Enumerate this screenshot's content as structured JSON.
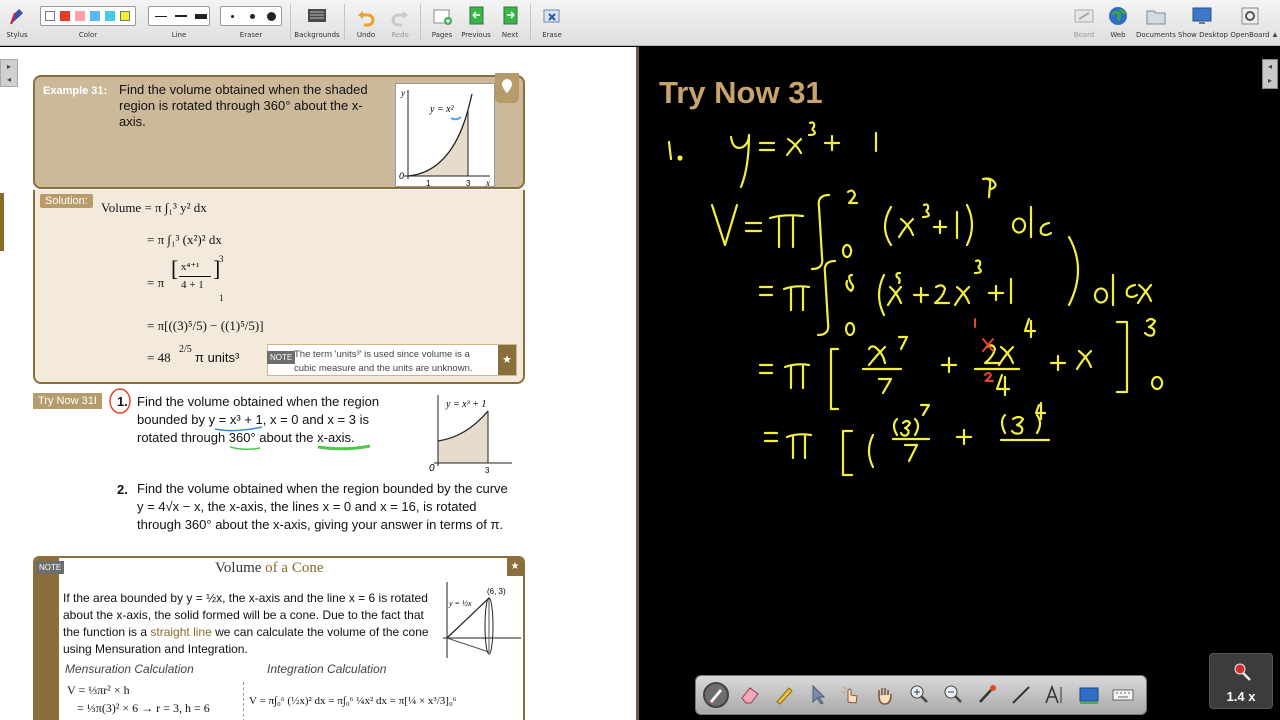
{
  "toolbar": {
    "stylus": "Stylus",
    "color": "Color",
    "line": "Line",
    "eraser": "Eraser",
    "backgrounds": "Backgrounds",
    "undo": "Undo",
    "redo": "Redo",
    "pages": "Pages",
    "previous": "Previous",
    "next": "Next",
    "erase": "Erase",
    "board": "Board",
    "web": "Web",
    "documents": "Documents",
    "show_desktop": "Show Desktop",
    "openboard": "OpenBoard",
    "colors": [
      "#ffffff",
      "#e53b2c",
      "#ff9ea6",
      "#5fb6f5",
      "#49c9e6",
      "#f6f02a"
    ]
  },
  "example": {
    "label": "Example 31:",
    "text": "Find the volume obtained when the shaded region is rotated through 360° about the x-axis.",
    "graph_label": "y = x²",
    "axis_y": "y",
    "axis_x": "x",
    "origin": "0",
    "tick1": "1",
    "tick3": "3"
  },
  "solution": {
    "label": "Solution:",
    "line1": "Volume = π ∫₁³ y² dx",
    "line2": "= π ∫₁³ (x²)² dx",
    "line3_left": "= π",
    "line3_num": "x⁴⁺¹",
    "line3_den": "4 + 1",
    "line3_lim_top": "3",
    "line3_lim_bot": "1",
    "line4": "= π[((3)⁵/5) − ((1)⁵/5)]",
    "line5_value": "= 48",
    "line5_frac": "2/5",
    "line5_units": "π  units³",
    "note_tag": "NOTE",
    "note_text": "The term 'units³' is used since volume is a cubic measure and the units are unknown."
  },
  "try_now": {
    "tag": "Try Now 31I",
    "q1_num": "1.",
    "q1_text": "Find the volume obtained when the region bounded by y = x³ + 1, x = 0 and x = 3 is rotated through 360° about the x-axis.",
    "q1_graph_label": "y = x³ + 1",
    "q1_origin": "0",
    "q1_tick": "3",
    "q2_num": "2.",
    "q2_text": "Find the volume obtained when the region bounded by the curve y = 4√x − x, the x-axis, the lines x = 0 and x = 16, is rotated through 360° about the x-axis, giving your answer in terms of π."
  },
  "cone": {
    "note_tag": "NOTE",
    "title_pre": "Volume",
    "title_of": "of a",
    "title_post": "Cone",
    "text_a": "If the area bounded by y = ½x, the x-axis and the line x = 6 is rotated about the x-axis, the solid formed will be a cone. Due to the fact that the function is a ",
    "text_link": "straight line",
    "text_b": " we can calculate the volume of the cone using Mensuration and Integration.",
    "mensuration": "Mensuration Calculation",
    "integration": "Integration Calculation",
    "m_line1": "V = ⅓πr² × h",
    "m_line2": "= ⅓π(3)² × 6   → r = 3, h = 6",
    "i_line": "V = π∫₀⁶ (½x)² dx = π∫₀⁶ ¼x² dx = π[¼ × x³/3]₀⁶",
    "graph_label": "y = ½x",
    "point": "(6, 3)"
  },
  "board": {
    "title": "Try Now 31",
    "ink_color": "#f2ef3e",
    "correction_color": "#e8432e"
  },
  "zoom": {
    "label": "1.4 x"
  }
}
